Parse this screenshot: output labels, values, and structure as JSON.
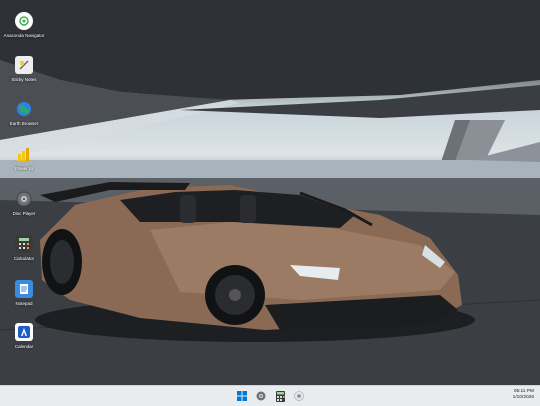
{
  "desktop": {
    "icons": [
      {
        "name": "anaconda-icon",
        "label": "Anaconda Navigator"
      },
      {
        "name": "sticky-notes-icon",
        "label": "Sticky Notes"
      },
      {
        "name": "globe-icon",
        "label": "Earth Browser"
      },
      {
        "name": "bar-chart-icon",
        "label": "Power BI"
      },
      {
        "name": "disc-icon",
        "label": "Disc Player"
      },
      {
        "name": "calculator-icon",
        "label": "Calculator"
      },
      {
        "name": "notepad-icon",
        "label": "Notepad"
      },
      {
        "name": "app-store-icon",
        "label": "Calendar"
      }
    ]
  },
  "taskbar": {
    "items": [
      "start-icon",
      "disc-icon",
      "calculator-icon",
      "chrome-icon"
    ],
    "time": "05:11 PM",
    "date": "1/10/2026"
  },
  "colors": {
    "taskbar_bg": "#e9ecef",
    "accent": "#0078d4",
    "car_body": "#8a6a55"
  }
}
